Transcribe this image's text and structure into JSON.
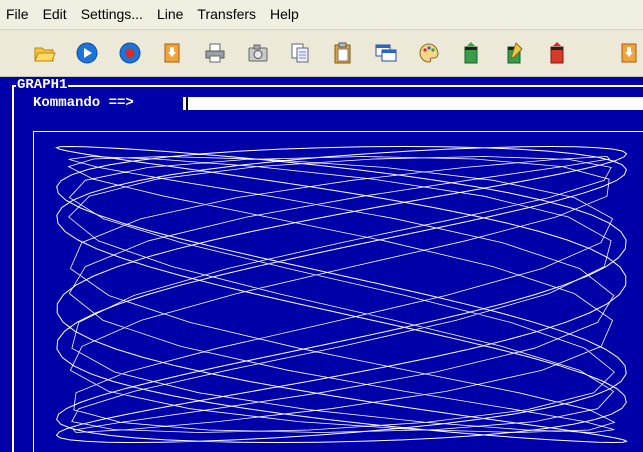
{
  "menu": {
    "file": "File",
    "edit": "Edit",
    "settings": "Settings...",
    "line": "Line",
    "transfers": "Transfers",
    "help": "Help"
  },
  "toolbar": {
    "icons": [
      "folder-open-icon",
      "play-icon",
      "record-icon",
      "download-icon",
      "printer-icon",
      "camera-icon",
      "copy-icon",
      "paste-icon",
      "windows-icon",
      "palette-icon",
      "transfer-up-icon",
      "edit-transfer-icon",
      "transfer-down-icon",
      "receive-icon"
    ]
  },
  "terminal": {
    "graph_title": "GRAPH1",
    "command_label": "Kommando ==>",
    "command_value": "",
    "background": "#0000a8",
    "foreground": "#ffffff"
  },
  "plot": {
    "line_color": "#ffffff"
  }
}
